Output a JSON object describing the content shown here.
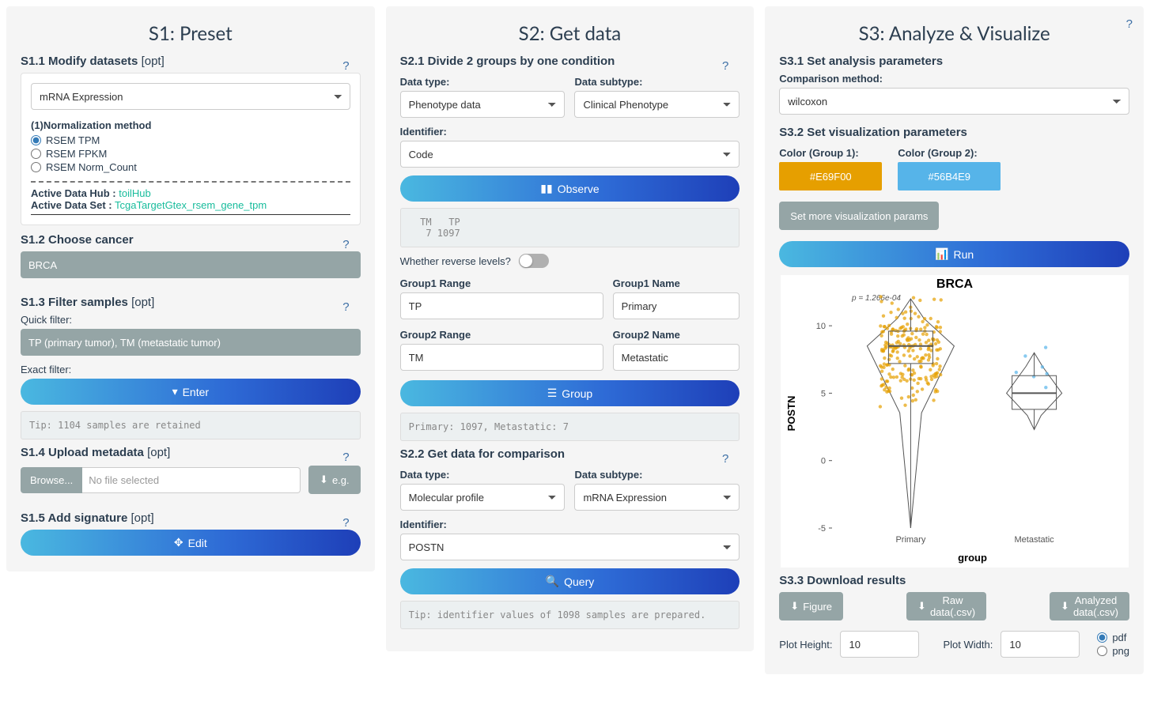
{
  "s1": {
    "title": "S1: Preset",
    "s11": {
      "h": "S1.1 Modify datasets",
      "opt": "[opt]",
      "dataset": "mRNA Expression",
      "normLabel": "(1)Normalization method",
      "r1": "RSEM TPM",
      "r2": "RSEM FPKM",
      "r3": "RSEM Norm_Count",
      "hubL": "Active Data Hub :",
      "hubV": "toilHub",
      "setL": "Active Data Set :",
      "setV": "TcgaTargetGtex_rsem_gene_tpm"
    },
    "s12": {
      "h": "S1.2 Choose cancer",
      "v": "BRCA"
    },
    "s13": {
      "h": "S1.3 Filter samples",
      "opt": "[opt]",
      "qf": "Quick filter:",
      "qfv": "TP (primary tumor), TM (metastatic tumor)",
      "ef": "Exact filter:",
      "enter": "Enter",
      "tip": "Tip: 1104 samples are retained"
    },
    "s14": {
      "h": "S1.4 Upload metadata",
      "opt": "[opt]",
      "browse": "Browse...",
      "nofile": "No file selected",
      "eg": "e.g."
    },
    "s15": {
      "h": "S1.5 Add signature",
      "opt": "[opt]",
      "edit": "Edit"
    }
  },
  "s2": {
    "title": "S2: Get data",
    "s21": {
      "h": "S2.1 Divide 2 groups by one condition",
      "dtL": "Data type:",
      "dtV": "Phenotype data",
      "dsL": "Data subtype:",
      "dsV": "Clinical Phenotype",
      "idL": "Identifier:",
      "idV": "Code",
      "obs": "Observe",
      "obsOut": "  TM   TP\n   7 1097",
      "rev": "Whether reverse levels?",
      "g1rL": "Group1 Range",
      "g1rV": "TP",
      "g1nL": "Group1 Name",
      "g1nV": "Primary",
      "g2rL": "Group2 Range",
      "g2rV": "TM",
      "g2nL": "Group2 Name",
      "g2nV": "Metastatic",
      "grp": "Group",
      "grpOut": "Primary: 1097, Metastatic: 7"
    },
    "s22": {
      "h": "S2.2 Get data for comparison",
      "dtL": "Data type:",
      "dtV": "Molecular profile",
      "dsL": "Data subtype:",
      "dsV": "mRNA Expression",
      "idL": "Identifier:",
      "idV": "POSTN",
      "q": "Query",
      "qOut": "Tip: identifier values of 1098 samples are prepared."
    }
  },
  "s3": {
    "title": "S3: Analyze & Visualize",
    "s31": {
      "h": "S3.1 Set analysis parameters",
      "cmL": "Comparison method:",
      "cmV": "wilcoxon"
    },
    "s32": {
      "h": "S3.2 Set visualization parameters",
      "c1L": "Color (Group 1):",
      "c1V": "#E69F00",
      "c2L": "Color (Group 2):",
      "c2V": "#56B4E9",
      "more": "Set more visualization params",
      "run": "Run"
    },
    "s33": {
      "h": "S3.3 Download results",
      "fig": "Figure",
      "raw": "Raw data(.csv)",
      "ana": "Analyzed data(.csv)",
      "phL": "Plot Height:",
      "phV": "10",
      "pwL": "Plot Width:",
      "pwV": "10",
      "pdf": "pdf",
      "png": "png"
    }
  },
  "chart_data": {
    "type": "violin+box+jitter",
    "title": "BRCA",
    "annotation": "p = 1.266e-04",
    "xlabel": "group",
    "ylabel": "POSTN",
    "categories": [
      "Primary",
      "Metastatic"
    ],
    "ylim": [
      -5,
      12
    ],
    "yticks": [
      -5,
      0,
      5,
      10
    ],
    "series": [
      {
        "name": "Primary",
        "color": "#E69F00",
        "n": 1097,
        "box": {
          "min": -5,
          "q1": 7.2,
          "median": 8.5,
          "q3": 9.6,
          "max": 12
        }
      },
      {
        "name": "Metastatic",
        "color": "#56B4E9",
        "n": 7,
        "box": {
          "min": 2.3,
          "q1": 3.8,
          "median": 5.0,
          "q3": 6.3,
          "max": 8.0
        }
      }
    ]
  }
}
